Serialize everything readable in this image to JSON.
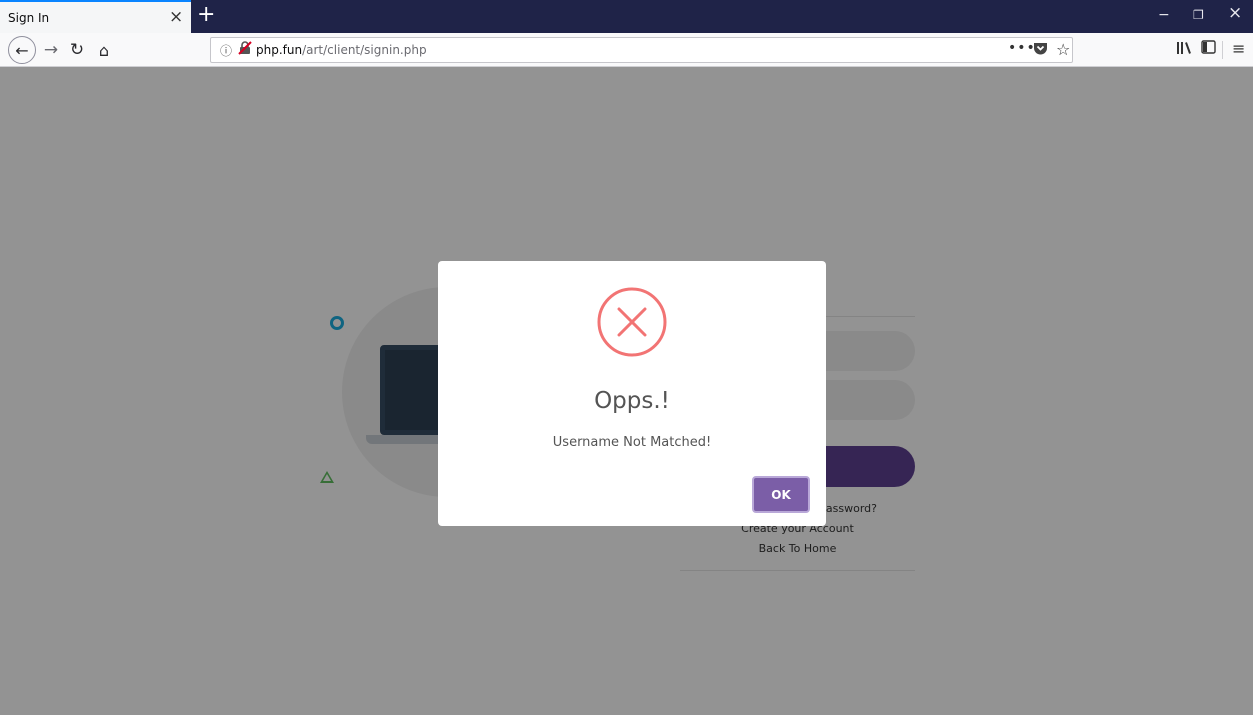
{
  "browser": {
    "tab_title": "Sign In",
    "tab_close_glyph": "×",
    "new_tab_glyph": "+",
    "window_controls": {
      "minimize": "−",
      "restore": "❐",
      "close": "×"
    },
    "url_host": "php.fun",
    "url_path": "/art/client/signin.php",
    "page_actions_glyph": "•••",
    "icons": [
      "back-icon",
      "forward-icon",
      "reload-icon",
      "home-icon",
      "info-icon",
      "insecure-lock-icon",
      "pocket-icon",
      "bookmark-star-icon",
      "library-icon",
      "sidebar-icon",
      "menu-icon"
    ]
  },
  "page": {
    "signin_title_visible": "N",
    "forgot_password_visible": "assword?",
    "create_account": "Create your Account",
    "back_home": "Back To Home"
  },
  "modal": {
    "title": "Opps.!",
    "message": "Username Not Matched!",
    "ok_label": "OK",
    "icon": "error-x-icon",
    "accent_color": "#f27474",
    "button_color": "#7b5ea7"
  }
}
